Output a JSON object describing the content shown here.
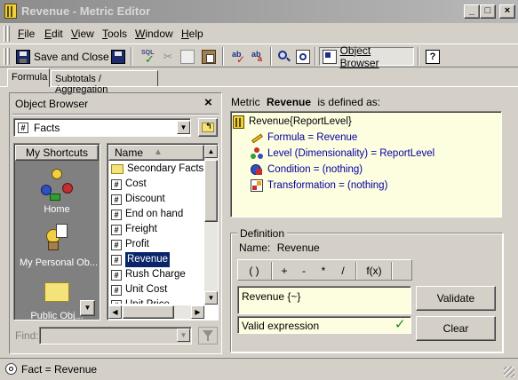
{
  "window": {
    "title": "Revenue - Metric Editor",
    "minimize": "_",
    "maximize": "□",
    "close": "×"
  },
  "menu": [
    {
      "label": "File",
      "u": "F",
      "rest": "ile"
    },
    {
      "label": "Edit",
      "u": "E",
      "rest": "dit"
    },
    {
      "label": "View",
      "u": "V",
      "rest": "iew"
    },
    {
      "label": "Tools",
      "u": "T",
      "rest": "ools"
    },
    {
      "label": "Window",
      "u": "W",
      "rest": "indow"
    },
    {
      "label": "Help",
      "u": "H",
      "rest": "elp"
    }
  ],
  "toolbar": {
    "save_and_close": "Save and Close",
    "object_browser": "Object Browser",
    "help": "?"
  },
  "tabs": [
    {
      "label": "Formula"
    },
    {
      "label": "Subtotals / Aggregation"
    }
  ],
  "object_browser": {
    "title": "Object Browser",
    "close": "×",
    "folder": "Facts",
    "shortcuts_header": "My Shortcuts",
    "shortcuts": [
      {
        "label": "Home"
      },
      {
        "label": "My Personal Ob..."
      },
      {
        "label": "Public Obj..."
      }
    ],
    "list_header": "Name",
    "items": [
      {
        "label": "Secondary Facts",
        "type": "folder"
      },
      {
        "label": "Cost",
        "type": "fact"
      },
      {
        "label": "Discount",
        "type": "fact"
      },
      {
        "label": "End on hand",
        "type": "fact"
      },
      {
        "label": "Freight",
        "type": "fact"
      },
      {
        "label": "Profit",
        "type": "fact"
      },
      {
        "label": "Revenue",
        "type": "fact",
        "selected": true
      },
      {
        "label": "Rush Charge",
        "type": "fact"
      },
      {
        "label": "Unit Cost",
        "type": "fact"
      },
      {
        "label": "Unit Price",
        "type": "fact"
      }
    ],
    "find_label": "Find:",
    "find_value": ""
  },
  "metric": {
    "prefix": "Metric",
    "name": "Revenue",
    "suffix": "is defined as:",
    "root": "Revenue{ReportLevel}",
    "children": [
      {
        "label": "Formula = Revenue",
        "icon": "formula-icon",
        "color": "#0000a0"
      },
      {
        "label": "Level (Dimensionality) = ReportLevel",
        "icon": "level-icon",
        "color": "#0000a0"
      },
      {
        "label": "Condition = (nothing)",
        "icon": "condition-icon",
        "color": "#0000a0"
      },
      {
        "label": "Transformation = (nothing)",
        "icon": "transformation-icon",
        "color": "#0000a0"
      }
    ]
  },
  "definition": {
    "group_title": "Definition",
    "name_label": "Name:",
    "name_value": "Revenue",
    "operators": [
      "( )",
      "+",
      "-",
      "*",
      "/",
      "f(x)"
    ],
    "expression": "Revenue {~}",
    "status": "Valid expression",
    "validate": "Validate",
    "clear": "Clear"
  },
  "status": {
    "text": "Fact = Revenue"
  },
  "colors": {
    "selection": "#0a246a",
    "highlight_bg": "#fdfde0",
    "shortcuts_bg": "#808080"
  }
}
